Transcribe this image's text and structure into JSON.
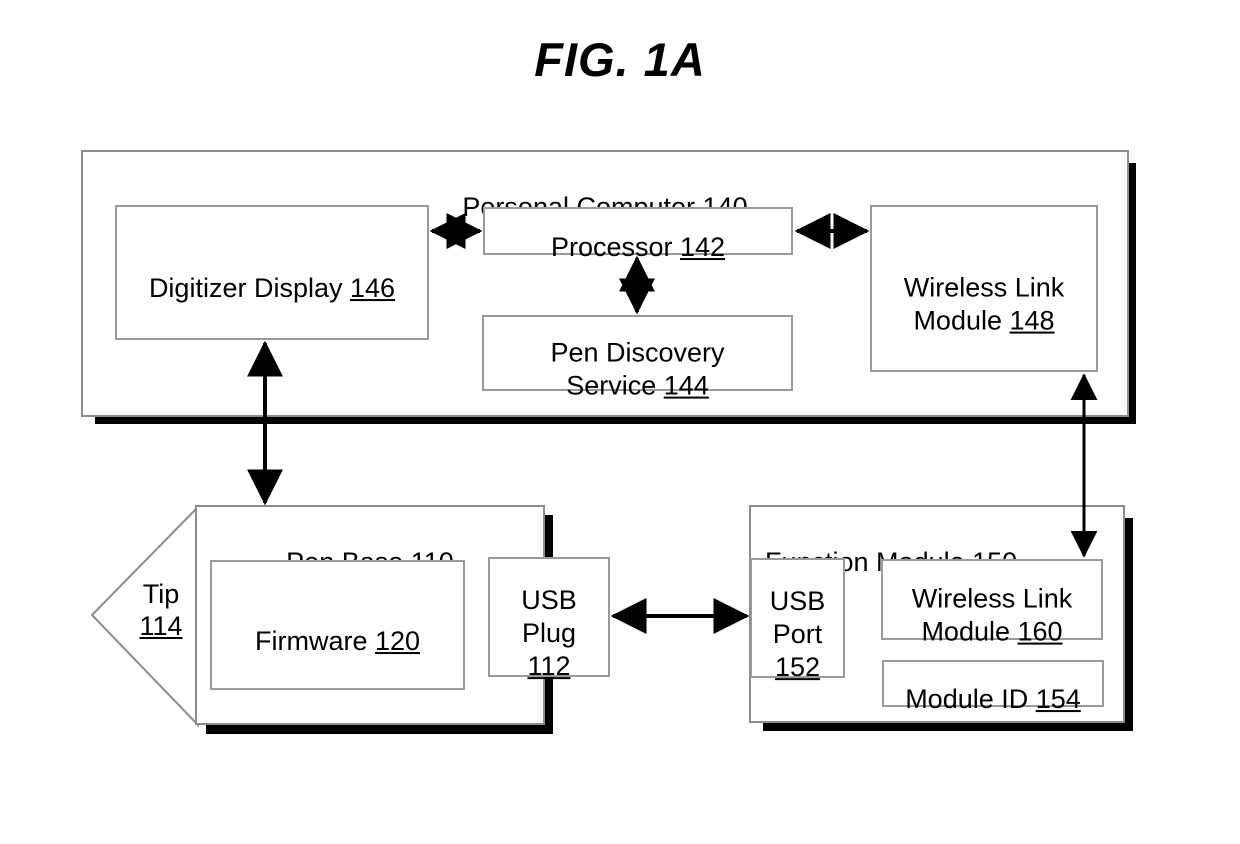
{
  "figure": {
    "title": "FIG. 1A",
    "background_color": "#ffffff",
    "line_color": "#8c8c8c",
    "shadow_color": "#000000",
    "text_color": "#000000"
  },
  "personal_computer": {
    "title_text": "Personal Computer ",
    "title_ref": "140",
    "digitizer_display": {
      "text": "Digitizer Display ",
      "ref": "146"
    },
    "processor": {
      "text": "Processor ",
      "ref": "142"
    },
    "pen_discovery_service": {
      "text": "Pen Discovery\nService ",
      "ref": "144"
    },
    "wireless_link_module": {
      "text": "Wireless Link\nModule ",
      "ref": "148"
    }
  },
  "pen_base": {
    "title_text": "Pen Base ",
    "title_ref": "110",
    "tip": {
      "text": "Tip",
      "ref": "114"
    },
    "firmware": {
      "text": "Firmware ",
      "ref": "120"
    },
    "usb_plug": {
      "text": "USB\nPlug\n",
      "ref": "112"
    }
  },
  "function_module": {
    "title_text": "Function Module ",
    "title_ref": "150",
    "usb_port": {
      "text": "USB\nPort\n",
      "ref": "152"
    },
    "wireless_link_module": {
      "text": "Wireless Link\nModule ",
      "ref": "160"
    },
    "module_id": {
      "text": "Module ID ",
      "ref": "154"
    }
  },
  "connections": [
    {
      "name": "digitizer-display-to-processor",
      "style": "double-headed",
      "orientation": "horizontal"
    },
    {
      "name": "processor-to-wireless-link-module-148",
      "style": "double-headed",
      "orientation": "horizontal"
    },
    {
      "name": "processor-to-pen-discovery-service",
      "style": "double-headed",
      "orientation": "vertical"
    },
    {
      "name": "digitizer-display-to-pen-base",
      "style": "double-headed",
      "orientation": "vertical"
    },
    {
      "name": "usb-plug-to-usb-port",
      "style": "double-headed",
      "orientation": "horizontal"
    },
    {
      "name": "wireless-link-module-148-to-wireless-link-module-160",
      "style": "double-headed",
      "orientation": "vertical"
    }
  ]
}
